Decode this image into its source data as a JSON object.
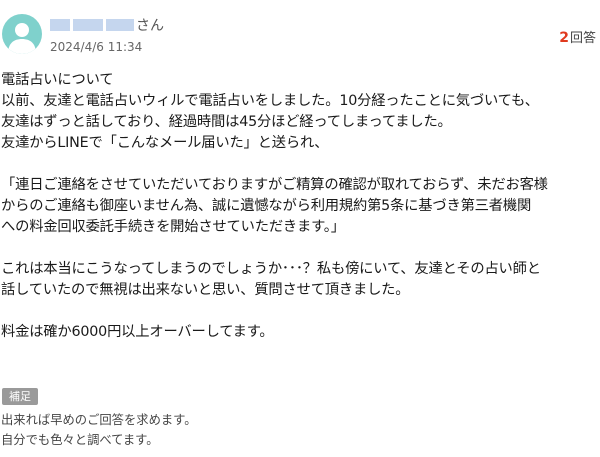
{
  "question": {
    "user": {
      "name_suffix": "さん",
      "avatar_icon": "person-icon",
      "avatar_color": "#7fd1cc"
    },
    "posted_at": "2024/4/6 11:34",
    "answers": {
      "count": "2",
      "label": "回答",
      "count_color": "#e03a1f"
    },
    "body_lines": [
      "電話占いについて",
      "以前、友達と電話占いウィルで電話占いをしました。10分経ったことに気づいても、",
      "友達はずっと話しており、経過時間は45分ほど経ってしまってました。",
      "友達からLINEで「こんなメール届いた」と送られ、",
      "",
      "「連日ご連絡をさせていただいておりますがご精算の確認が取れておらず、未だお客様",
      "からのご連絡も御座いません為、誠に遺憾ながら利用規約第5条に基づき第三者機関",
      "への料金回収委託手続きを開始させていただきます。」",
      "",
      "これは本当にこうなってしまうのでしょうか･･･？私も傍にいて、友達とその占い師と",
      "話していたので無視は出来ないと思い、質問させて頂きました。",
      "",
      "料金は確か6000円以上オーバーしてます。"
    ],
    "supplement": {
      "tag": "補足",
      "lines": [
        "出来れば早めのご回答を求めます。",
        "自分でも色々と調べてます。"
      ]
    }
  }
}
